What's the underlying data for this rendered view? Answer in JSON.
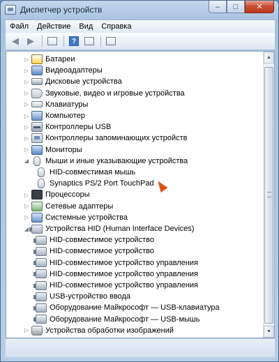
{
  "window": {
    "title": "Диспетчер устройств",
    "controls": {
      "minimize": "–",
      "maximize": "□",
      "close": "✕"
    }
  },
  "menu": [
    {
      "label": "Файл"
    },
    {
      "label": "Действие"
    },
    {
      "label": "Вид"
    },
    {
      "label": "Справка"
    }
  ],
  "toolbar": {
    "back_icon": "arrow-left-icon",
    "forward_icon": "arrow-right-icon",
    "properties_icon": "properties-icon",
    "help_icon": "help-icon",
    "help_label": "?",
    "view_icon": "view-icon",
    "scan_icon": "scan-hardware-icon"
  },
  "tree": [
    {
      "label": "Батареи",
      "expander": "▷",
      "icon": "battery"
    },
    {
      "label": "Видеоадаптеры",
      "expander": "▷",
      "icon": "monitor"
    },
    {
      "label": "Дисковые устройства",
      "expander": "▷",
      "icon": "disk"
    },
    {
      "label": "Звуковые, видео и игровые устройства",
      "expander": "▷",
      "icon": "sound"
    },
    {
      "label": "Клавиатуры",
      "expander": "▷",
      "icon": "keyboard"
    },
    {
      "label": "Компьютер",
      "expander": "▷",
      "icon": "computer"
    },
    {
      "label": "Контроллеры USB",
      "expander": "▷",
      "icon": "usb"
    },
    {
      "label": "Контроллеры запоминающих устройств",
      "expander": "▷",
      "icon": "dev"
    },
    {
      "label": "Мониторы",
      "expander": "▷",
      "icon": "monitor"
    },
    {
      "label": "Мыши и иные указывающие устройства",
      "expander": "◢",
      "icon": "mouse"
    },
    {
      "label": "HID-совместимая мышь",
      "child": true,
      "icon": "mouse"
    },
    {
      "label": "Synaptics PS/2 Port TouchPad",
      "child": true,
      "icon": "mouse"
    },
    {
      "label": "Процессоры",
      "expander": "▷",
      "icon": "cpu"
    },
    {
      "label": "Сетевые адаптеры",
      "expander": "▷",
      "icon": "net"
    },
    {
      "label": "Системные устройства",
      "expander": "▷",
      "icon": "computer"
    },
    {
      "label": "Устройства HID (Human Interface Devices)",
      "expander": "◢",
      "icon": "hid"
    },
    {
      "label": "HID-совместимое устройство",
      "child": true,
      "icon": "hid"
    },
    {
      "label": "HID-совместимое устройство",
      "child": true,
      "icon": "hid"
    },
    {
      "label": "HID-совместимое устройство управления",
      "child": true,
      "icon": "hid"
    },
    {
      "label": "HID-совместимое устройство управления",
      "child": true,
      "icon": "hid"
    },
    {
      "label": "HID-совместимое устройство управления",
      "child": true,
      "icon": "hid"
    },
    {
      "label": "USB-устройство ввода",
      "child": true,
      "icon": "hid"
    },
    {
      "label": "Оборудование Майкрософт — USB-клавиатура",
      "child": true,
      "icon": "hid"
    },
    {
      "label": "Оборудование Майкрософт — USB-мышь",
      "child": true,
      "icon": "hid"
    },
    {
      "label": "Устройства обработки изображений",
      "expander": "▷",
      "icon": "camera"
    }
  ],
  "scrollbar": {
    "up": "▲",
    "down": "▼"
  }
}
